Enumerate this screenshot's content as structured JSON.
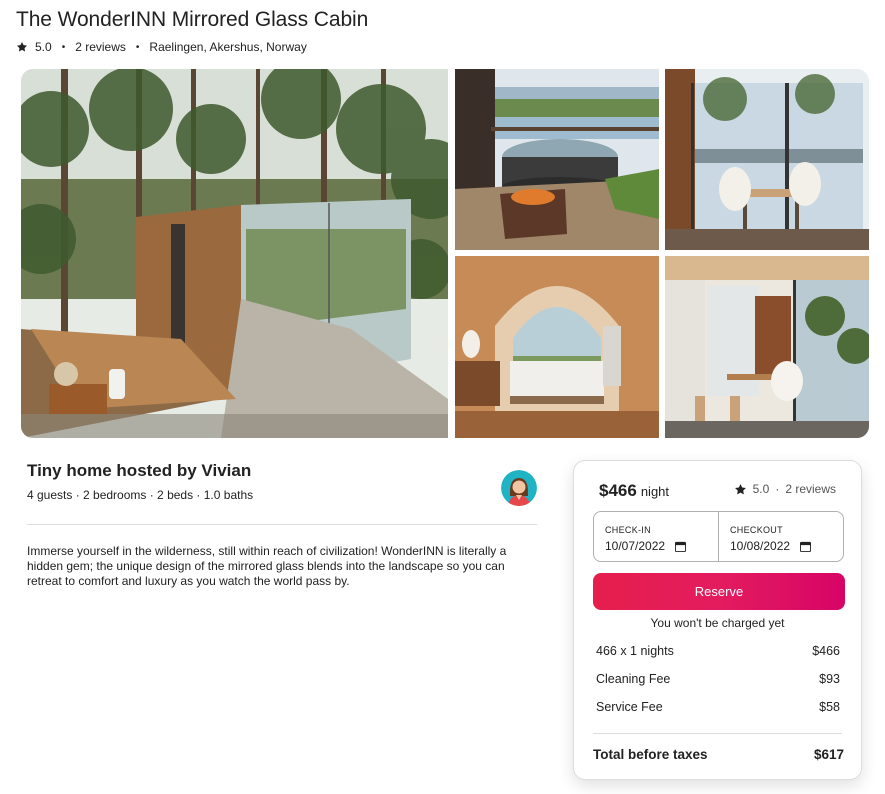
{
  "listing": {
    "title": "The WonderINN Mirrored Glass Cabin",
    "rating": "5.0",
    "reviews": "2 reviews",
    "location": "Raelingen, Akershus, Norway"
  },
  "gallery": {
    "photos": [
      "mirrored-glass-cabin-exterior",
      "hot-tub-and-fire-pit",
      "dining-area-lake-view",
      "arched-bedroom",
      "kitchen-interior"
    ]
  },
  "host": {
    "title": "Tiny home hosted by Vivian",
    "details": "4 guests · 2 bedrooms · 2 beds · 1.0 baths"
  },
  "description": "Immerse yourself in the wilderness, still within reach of civilization! WonderINN is literally a hidden gem; the unique design of the mirrored glass blends into the landscape so you can retreat to comfort and luxury as you watch the world pass by.",
  "booking": {
    "price": "$466",
    "per_night": "night",
    "rating": "5.0",
    "reviews": "2 reviews",
    "checkin_label": "CHECK-IN",
    "checkin_value": "10/07/2022",
    "checkout_label": "CHECKOUT",
    "checkout_value": "10/08/2022",
    "reserve_label": "Reserve",
    "no_charge": "You won't be charged yet",
    "lines": [
      {
        "label": "466 x 1 nights",
        "amount": "$466"
      },
      {
        "label": "Cleaning Fee",
        "amount": "$93"
      },
      {
        "label": "Service Fee",
        "amount": "$58"
      }
    ],
    "total_label": "Total before taxes",
    "total_amount": "$617"
  },
  "icons": {
    "star": "star-icon",
    "calendar": "calendar-icon"
  },
  "colors": {
    "reserve_start": "#e61e4d",
    "reserve_end": "#d70466",
    "text": "#222222",
    "border": "#dddddd"
  }
}
